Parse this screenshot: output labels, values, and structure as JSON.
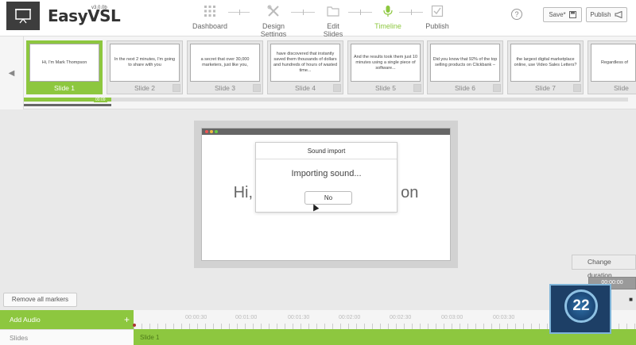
{
  "header": {
    "app_name": "EasyVSL",
    "version": "v3.0.0b",
    "steps": [
      {
        "label": "Dashboard"
      },
      {
        "label": "Design Settings"
      },
      {
        "label": "Edit Slides"
      },
      {
        "label": "Timeline"
      },
      {
        "label": "Publish"
      }
    ],
    "active_step": "Timeline",
    "help": "?",
    "save_label": "Save*",
    "publish_label": "Publish"
  },
  "slides": [
    {
      "label": "Slide 1",
      "text": "Hi, I'm Mark Thompson"
    },
    {
      "label": "Slide 2",
      "text": "In the next 2 minutes, I'm going to share with you"
    },
    {
      "label": "Slide 3",
      "text": "a secret that over 30,000 marketers, just like you,"
    },
    {
      "label": "Slide 4",
      "text": "have discovered that instantly saved them thousands of dollars and hundreds of hours of wasted time..."
    },
    {
      "label": "Slide 5",
      "text": "And the results took them just 10 minutes using a single piece of software..."
    },
    {
      "label": "Slide 6",
      "text": "Did you know that 92% of the top selling products on Clickbank –"
    },
    {
      "label": "Slide 7",
      "text": "the largest digital marketplace online, use Video Sales Letters?"
    },
    {
      "label": "Slide",
      "text": "Regardless of"
    }
  ],
  "progress_time": "00:09",
  "preview": {
    "text_left": "Hi,",
    "text_right": "on"
  },
  "modal": {
    "title": "Sound import",
    "message": "Importing sound...",
    "button": "No"
  },
  "right_panel": {
    "change_duration": "Change duration",
    "duration_value": "00:00:00"
  },
  "timeline": {
    "remove_markers": "Remove all markers",
    "add_audio": "Add Audio",
    "add_plus": "+",
    "slides_label": "Slides",
    "track_label": "Slide 1",
    "ticks": [
      "00:00:30",
      "00:01:00",
      "00:01:30",
      "00:02:00",
      "00:02:30",
      "00:03:00",
      "00:03:30"
    ]
  },
  "badge": {
    "number": "22"
  },
  "colors": {
    "accent": "#8dc73f",
    "dark": "#3d3d3d"
  }
}
